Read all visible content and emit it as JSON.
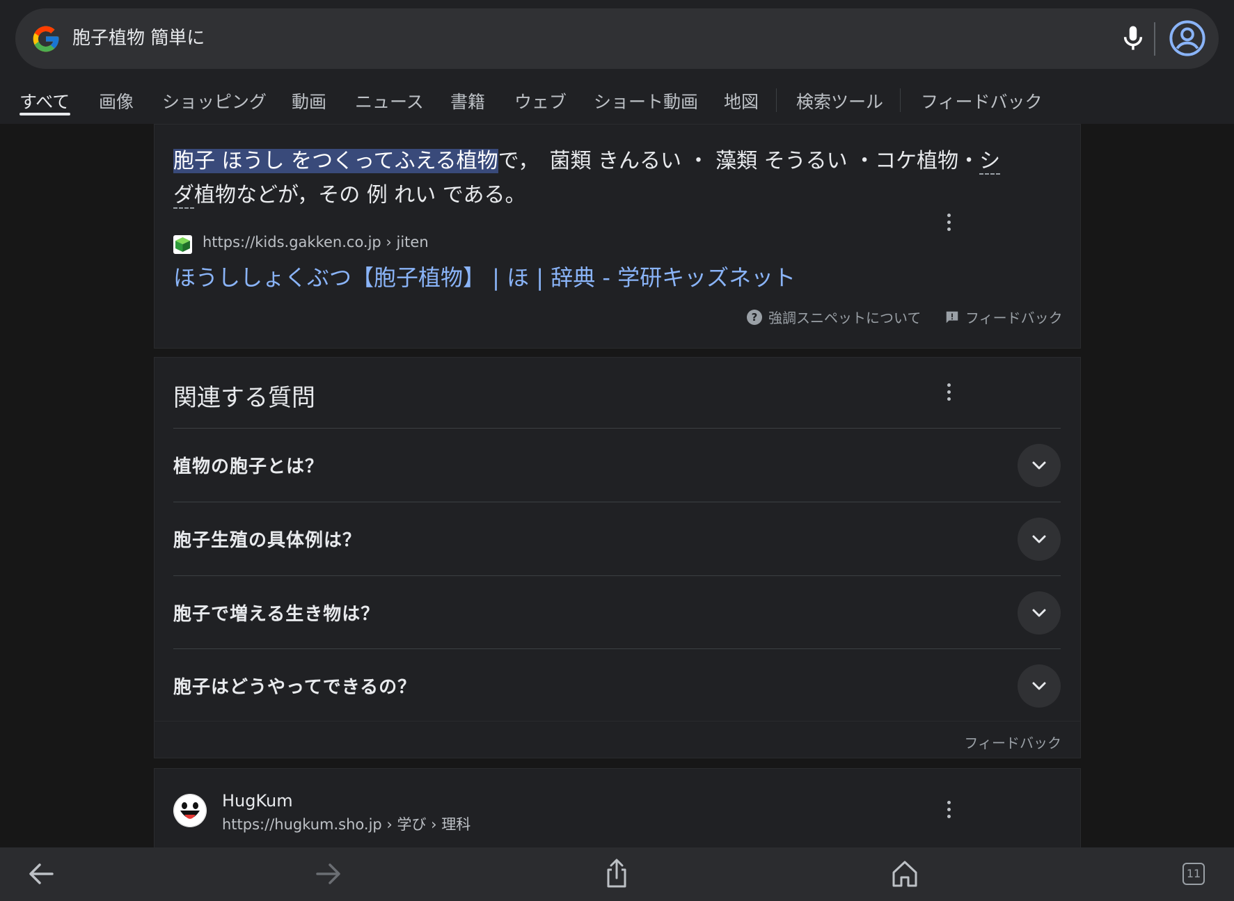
{
  "search": {
    "query": "胞子植物 簡単に"
  },
  "tabs": [
    {
      "label": "すべて",
      "active": true
    },
    {
      "label": "画像"
    },
    {
      "label": "ショッピング"
    },
    {
      "label": "動画"
    },
    {
      "label": "ニュース"
    },
    {
      "label": "書籍"
    },
    {
      "label": "ウェブ"
    },
    {
      "label": "ショート動画"
    },
    {
      "label": "地図"
    },
    {
      "label": "検索ツール"
    },
    {
      "label": "フィードバック"
    }
  ],
  "snippet": {
    "highlighted": "胞子 ほうし をつくってふえる植物",
    "text_1": "で，　菌類 きんるい ・ 藻類 そうるい ・コケ植物・",
    "text_dashed_1": "シ",
    "text_dashed_2": "ダ",
    "text_2": "植物などが，その 例 れい である。",
    "source_url": "https://kids.gakken.co.jp › jiten",
    "title": "ほうししょくぶつ【胞子植物】 | ほ | 辞典 - 学研キッズネット",
    "about_label": "強調スニペットについて",
    "feedback_label": "フィードバック"
  },
  "paa": {
    "title": "関連する質問",
    "questions": [
      "植物の胞子とは？",
      "胞子生殖の具体例は？",
      "胞子で増える生き物は？",
      "胞子はどうやってできるの？"
    ],
    "feedback_label": "フィードバック"
  },
  "hugkum": {
    "site_name": "HugKum",
    "url": "https://hugkum.sho.jp › 学び › 理科"
  },
  "bottom_bar": {
    "tab_count": "11"
  },
  "colors": {
    "background": "#171717",
    "card": "#202124",
    "link": "#8ab4f8",
    "highlight": "#394a7a"
  }
}
